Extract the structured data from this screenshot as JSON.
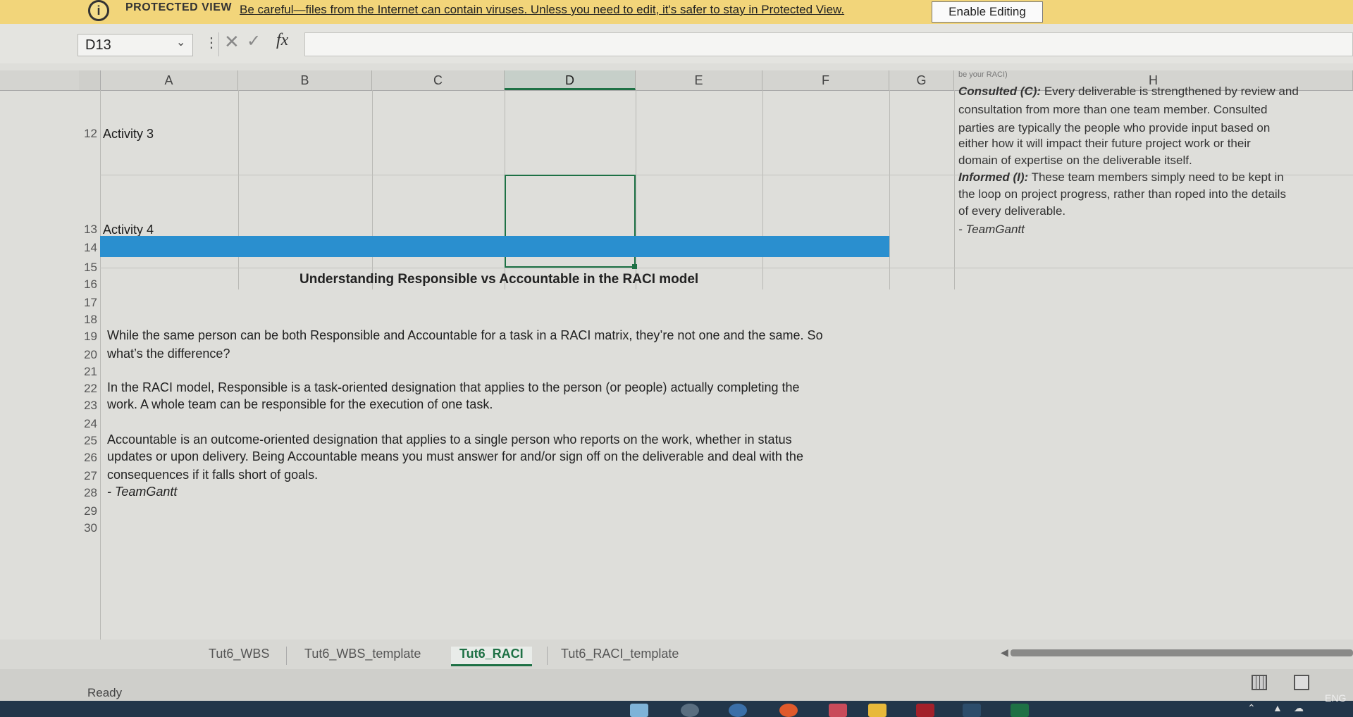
{
  "protected_view": {
    "icon": "info-icon",
    "title": "PROTECTED VIEW",
    "message": "Be careful—files from the Internet can contain viruses. Unless you need to edit, it's safer to stay in Protected View.",
    "button_label": "Enable Editing"
  },
  "formula_bar": {
    "name_box": "D13",
    "fx": "fx",
    "formula_value": ""
  },
  "columns": [
    "A",
    "B",
    "C",
    "D",
    "E",
    "F",
    "G",
    "H"
  ],
  "selected_column": "D",
  "rows": {
    "r12": "12",
    "r13": "13",
    "r14": "14",
    "r15": "15",
    "r16": "16",
    "r17": "17",
    "r18": "18",
    "r19": "19",
    "r20": "20",
    "r21": "21",
    "r22": "22",
    "r23": "23",
    "r24": "24",
    "r25": "25",
    "r26": "26",
    "r27": "27",
    "r28": "28",
    "r29": "29",
    "r30": "30"
  },
  "cells": {
    "a12": "Activity 3",
    "a13": "Activity 4"
  },
  "h_notes": {
    "top_fragment": "be your RACI)",
    "consulted_label": "Consulted (C):",
    "consulted_l1": " Every deliverable is strengthened by review and",
    "consulted_l2": "consultation from more than one team member. Consulted",
    "consulted_l3": "parties are typically the people who provide input based on",
    "consulted_l4": "either how it will impact their future project work or their",
    "consulted_l5": "domain of expertise on the deliverable itself.",
    "informed_label": "Informed (I):",
    "informed_l1": " These team members simply need to be kept in",
    "informed_l2": "the loop on project progress, rather than roped into the details",
    "informed_l3": "of every deliverable.",
    "source": "- TeamGantt"
  },
  "section_title": "Understanding Responsible vs Accountable in the RACI model",
  "paragraphs": {
    "p19": "While the same person can be both Responsible and Accountable for a task in a RACI matrix, they’re not one and the same. So",
    "p20": "what’s the difference?",
    "p22": "In the RACI model, Responsible is a task-oriented designation that applies to the person (or people) actually completing the",
    "p23": "work. A whole team can be responsible for the execution of one task.",
    "p25": "Accountable is an outcome-oriented designation that applies to a single person who reports on the work, whether in status",
    "p26": "updates or upon delivery. Being Accountable means you must answer for and/or sign off on the deliverable and deal with the",
    "p27": "consequences if it falls short of goals.",
    "p28": "- TeamGantt"
  },
  "sheet_tabs": [
    "Tut6_WBS",
    "Tut6_WBS_template",
    "Tut6_RACI",
    "Tut6_RACI_template"
  ],
  "active_tab": "Tut6_RACI",
  "status": {
    "ready": "Ready",
    "language": "ENG"
  },
  "colors": {
    "accent_green": "#1e7145",
    "band_blue": "#2a8fcf",
    "protected_bar": "#f2d57a"
  }
}
